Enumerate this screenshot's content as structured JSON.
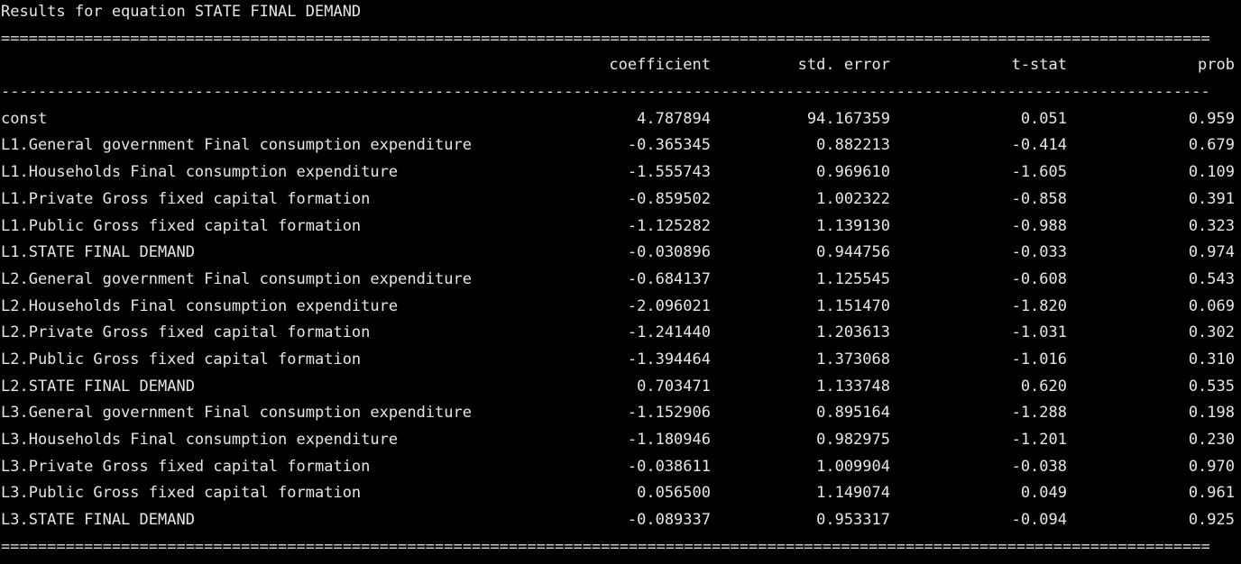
{
  "title": "Results for equation STATE FINAL DEMAND",
  "rules": {
    "double": "===================================================================================================================================",
    "single": "-----------------------------------------------------------------------------------------------------------------------------------"
  },
  "columns": {
    "label": "",
    "coefficient": "coefficient",
    "std_error": "std. error",
    "t_stat": "t-stat",
    "prob": "prob"
  },
  "rows": [
    {
      "label": "const",
      "coefficient": "4.787894",
      "std_error": "94.167359",
      "t_stat": "0.051",
      "prob": "0.959"
    },
    {
      "label": "L1.General government Final consumption expenditure",
      "coefficient": "-0.365345",
      "std_error": "0.882213",
      "t_stat": "-0.414",
      "prob": "0.679"
    },
    {
      "label": "L1.Households Final consumption expenditure",
      "coefficient": "-1.555743",
      "std_error": "0.969610",
      "t_stat": "-1.605",
      "prob": "0.109"
    },
    {
      "label": "L1.Private Gross fixed capital formation",
      "coefficient": "-0.859502",
      "std_error": "1.002322",
      "t_stat": "-0.858",
      "prob": "0.391"
    },
    {
      "label": "L1.Public Gross fixed capital formation",
      "coefficient": "-1.125282",
      "std_error": "1.139130",
      "t_stat": "-0.988",
      "prob": "0.323"
    },
    {
      "label": "L1.STATE FINAL DEMAND",
      "coefficient": "-0.030896",
      "std_error": "0.944756",
      "t_stat": "-0.033",
      "prob": "0.974"
    },
    {
      "label": "L2.General government Final consumption expenditure",
      "coefficient": "-0.684137",
      "std_error": "1.125545",
      "t_stat": "-0.608",
      "prob": "0.543"
    },
    {
      "label": "L2.Households Final consumption expenditure",
      "coefficient": "-2.096021",
      "std_error": "1.151470",
      "t_stat": "-1.820",
      "prob": "0.069"
    },
    {
      "label": "L2.Private Gross fixed capital formation",
      "coefficient": "-1.241440",
      "std_error": "1.203613",
      "t_stat": "-1.031",
      "prob": "0.302"
    },
    {
      "label": "L2.Public Gross fixed capital formation",
      "coefficient": "-1.394464",
      "std_error": "1.373068",
      "t_stat": "-1.016",
      "prob": "0.310"
    },
    {
      "label": "L2.STATE FINAL DEMAND",
      "coefficient": "0.703471",
      "std_error": "1.133748",
      "t_stat": "0.620",
      "prob": "0.535"
    },
    {
      "label": "L3.General government Final consumption expenditure",
      "coefficient": "-1.152906",
      "std_error": "0.895164",
      "t_stat": "-1.288",
      "prob": "0.198"
    },
    {
      "label": "L3.Households Final consumption expenditure",
      "coefficient": "-1.180946",
      "std_error": "0.982975",
      "t_stat": "-1.201",
      "prob": "0.230"
    },
    {
      "label": "L3.Private Gross fixed capital formation",
      "coefficient": "-0.038611",
      "std_error": "1.009904",
      "t_stat": "-0.038",
      "prob": "0.970"
    },
    {
      "label": "L3.Public Gross fixed capital formation",
      "coefficient": "0.056500",
      "std_error": "1.149074",
      "t_stat": "0.049",
      "prob": "0.961"
    },
    {
      "label": "L3.STATE FINAL DEMAND",
      "coefficient": "-0.089337",
      "std_error": "0.953317",
      "t_stat": "-0.094",
      "prob": "0.925"
    }
  ]
}
